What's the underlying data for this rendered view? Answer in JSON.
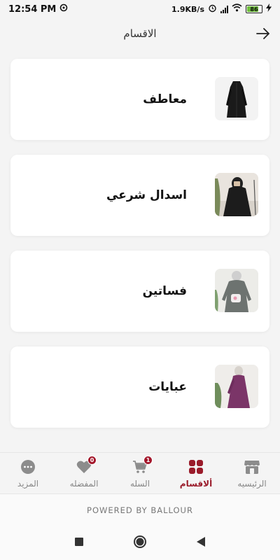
{
  "status_bar": {
    "time": "12:54 PM",
    "net_speed": "1.9KB/s",
    "battery": "86",
    "battery_level": 0.86
  },
  "header": {
    "title": "الاقسام",
    "back_icon": "arrow-right-icon"
  },
  "categories": [
    {
      "label": "معاطف",
      "image": "black-coat-photo"
    },
    {
      "label": "اسدال شرعي",
      "image": "black-prayer-dress-photo"
    },
    {
      "label": "فساتين",
      "image": "grey-dress-photo"
    },
    {
      "label": "عبايات",
      "image": "purple-abaya-photo"
    }
  ],
  "bottom_nav": {
    "items": [
      {
        "label": "الرئيسيه",
        "icon": "store-icon",
        "active": false
      },
      {
        "label": "ألاقسام",
        "icon": "grid-icon",
        "active": true
      },
      {
        "label": "السله",
        "icon": "cart-icon",
        "active": false,
        "badge": "1"
      },
      {
        "label": "المفضله",
        "icon": "heart-icon",
        "active": false,
        "badge": "0"
      },
      {
        "label": "المزيد",
        "icon": "more-icon",
        "active": false
      }
    ]
  },
  "footer": {
    "powered_by": "POWERED BY BALLOUR"
  },
  "colors": {
    "accent": "#9a1b2a",
    "badge": "#a3162a",
    "background": "#f4f4f4",
    "card": "#ffffff"
  }
}
